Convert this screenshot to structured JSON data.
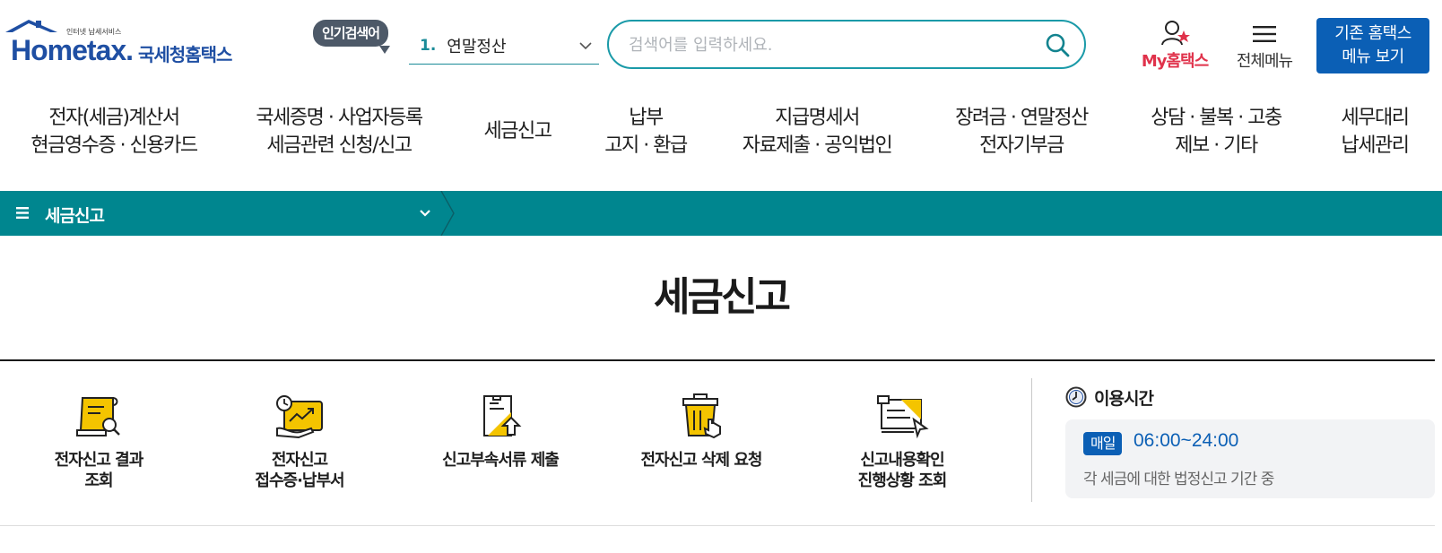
{
  "header": {
    "logo": {
      "small_text": "인터넷 납세서비스",
      "brand_en": "Hometax.",
      "brand_ko": "국세청홈택스"
    },
    "popular_search": {
      "badge": "인기검색어",
      "rank": "1.",
      "term": "연말정산"
    },
    "search": {
      "placeholder": "검색어를 입력하세요.",
      "value": ""
    },
    "my_hometax_label": "My홈택스",
    "all_menu_label": "전체메뉴",
    "old_home_button": {
      "line1": "기존 홈택스",
      "line2": "메뉴 보기"
    }
  },
  "gnb": {
    "items": [
      {
        "line1": "전자(세금)계산서",
        "line2": "현금영수증 · 신용카드"
      },
      {
        "line1": "국세증명 · 사업자등록",
        "line2": "세금관련 신청/신고"
      },
      {
        "line1": "세금신고",
        "line2": ""
      },
      {
        "line1": "납부",
        "line2": "고지 · 환급"
      },
      {
        "line1": "지급명세서",
        "line2": "자료제출 · 공익법인"
      },
      {
        "line1": "장려금 · 연말정산",
        "line2": "전자기부금"
      },
      {
        "line1": "상담 · 불복 · 고충",
        "line2": "제보 · 기타"
      },
      {
        "line1": "세무대리",
        "line2": "납세관리"
      }
    ]
  },
  "breadcrumb": {
    "label": "세금신고"
  },
  "page": {
    "title": "세금신고"
  },
  "quick_menu": {
    "items": [
      {
        "line1": "전자신고 결과",
        "line2": "조회",
        "icon": "document-search-icon"
      },
      {
        "line1": "전자신고",
        "line2": "접수증·납부서",
        "icon": "receipt-chart-icon"
      },
      {
        "line1": "신고부속서류 제출",
        "line2": "",
        "icon": "document-upload-icon"
      },
      {
        "line1": "전자신고 삭제 요청",
        "line2": "",
        "icon": "trash-delete-icon"
      },
      {
        "line1": "신고내용확인",
        "line2": "진행상황 조회",
        "icon": "progress-check-icon"
      }
    ]
  },
  "usage_time": {
    "heading": "이용시간",
    "badge": "매일",
    "hours": "06:00~24:00",
    "description": "각 세금에 대한 법정신고 기간 중"
  },
  "colors": {
    "teal": "#00868f",
    "brand_blue": "#0b5fb5",
    "accent_red": "#e0324b",
    "icon_yellow": "#f4c400"
  }
}
